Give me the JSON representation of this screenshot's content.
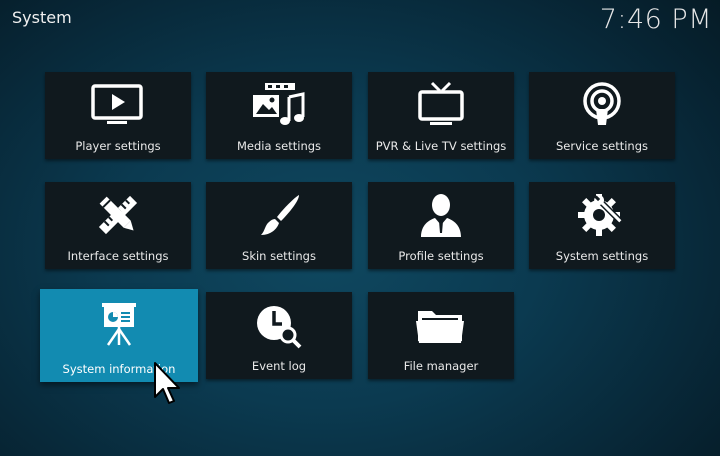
{
  "header": {
    "title": "System",
    "clock": "7:46 PM"
  },
  "tiles": [
    {
      "label": "Player settings",
      "icon": "tv-play-icon"
    },
    {
      "label": "Media settings",
      "icon": "media-icon"
    },
    {
      "label": "PVR & Live TV settings",
      "icon": "tv-antenna-icon"
    },
    {
      "label": "Service settings",
      "icon": "broadcast-icon"
    },
    {
      "label": "Interface settings",
      "icon": "pencil-ruler-icon"
    },
    {
      "label": "Skin settings",
      "icon": "paintbrush-icon"
    },
    {
      "label": "Profile settings",
      "icon": "user-profile-icon"
    },
    {
      "label": "System settings",
      "icon": "gear-wrench-icon"
    },
    {
      "label": "System information",
      "icon": "presentation-icon",
      "focused": true
    },
    {
      "label": "Event log",
      "icon": "clock-search-icon"
    },
    {
      "label": "File manager",
      "icon": "folder-icon"
    }
  ],
  "colors": {
    "focus": "#128bb1",
    "tile": "#10191e",
    "background": "#0b3a50"
  }
}
